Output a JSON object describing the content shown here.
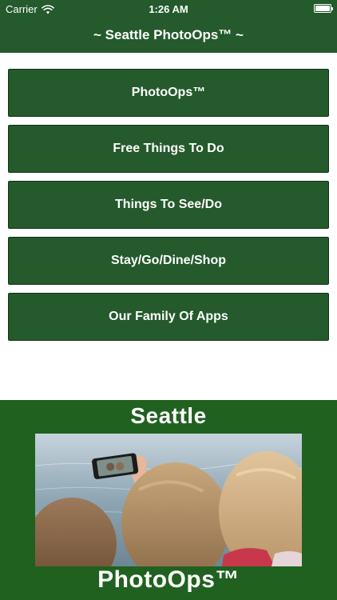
{
  "status_bar": {
    "carrier": "Carrier",
    "time": "1:26 AM"
  },
  "nav": {
    "title": "~ Seattle PhotoOps™ ~"
  },
  "menu": {
    "items": [
      {
        "label": "PhotoOps™"
      },
      {
        "label": "Free Things To Do"
      },
      {
        "label": "Things To See/Do"
      },
      {
        "label": "Stay/Go/Dine/Shop"
      },
      {
        "label": "Our Family Of Apps"
      }
    ]
  },
  "banner": {
    "title": "Seattle",
    "subtitle": "PhotoOps™"
  },
  "colors": {
    "brand_green": "#245a2c",
    "banner_green": "#20611f"
  }
}
